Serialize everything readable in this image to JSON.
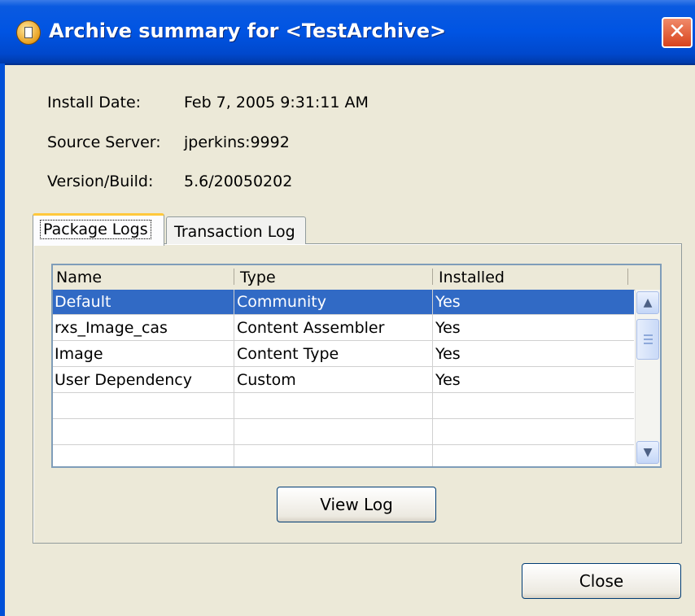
{
  "window": {
    "title": "Archive summary for <TestArchive>",
    "close_glyph": "✕"
  },
  "info": [
    {
      "label": "Install Date:",
      "value": "Feb 7, 2005 9:31:11 AM"
    },
    {
      "label": "Source Server:",
      "value": "jperkins:9992"
    },
    {
      "label": "Version/Build:",
      "value": "5.6/20050202"
    }
  ],
  "tabs": [
    {
      "label": "Package Logs",
      "selected": true
    },
    {
      "label": "Transaction Log",
      "selected": false
    }
  ],
  "table": {
    "columns": [
      "Name",
      "Type",
      "Installed"
    ],
    "rows": [
      [
        "Default",
        "Community",
        "Yes"
      ],
      [
        "rxs_Image_cas",
        "Content Assembler",
        "Yes"
      ],
      [
        "Image",
        "Content Type",
        "Yes"
      ],
      [
        "User Dependency",
        "Custom",
        "Yes"
      ],
      [
        "",
        "",
        ""
      ],
      [
        "",
        "",
        ""
      ],
      [
        "",
        "",
        ""
      ]
    ],
    "selected_row": 0
  },
  "buttons": {
    "view_log": "View Log",
    "close": "Close"
  },
  "colors": {
    "selection": "#316ac5",
    "titlebar": "#0054e3",
    "dialog": "#ece9d8"
  }
}
